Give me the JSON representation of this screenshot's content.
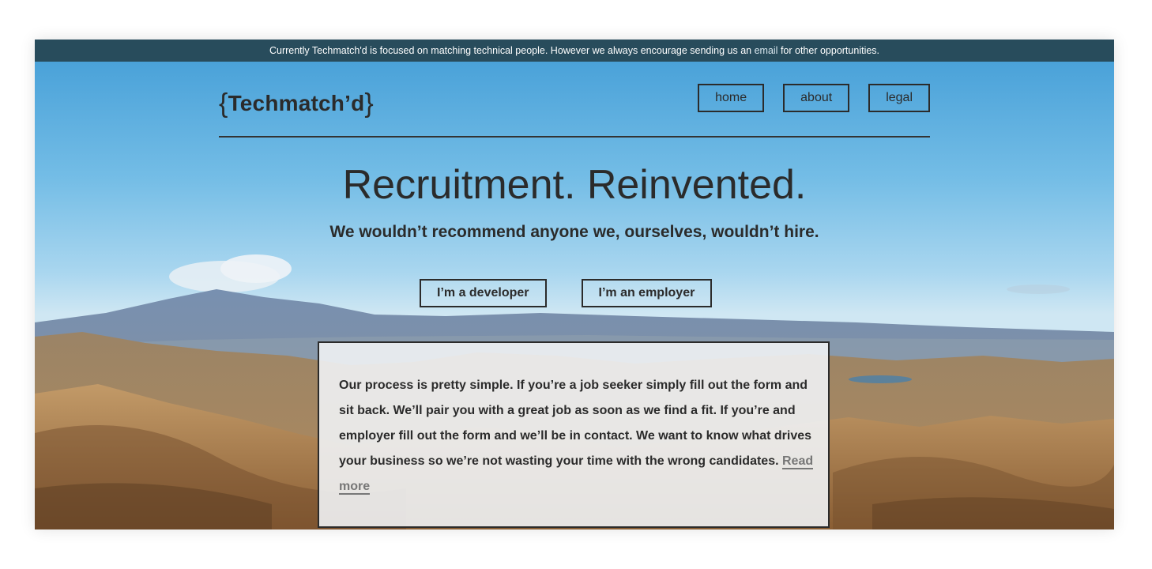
{
  "banner": {
    "text_before": "Currently Techmatch'd is focused on matching technical people. However we always encourage sending us an ",
    "email_link": "email",
    "text_after": " for other opportunities."
  },
  "header": {
    "logo_open": "{",
    "logo_text": "Techmatch’d",
    "logo_close": "}",
    "nav": {
      "home": "home",
      "about": "about",
      "legal": "legal"
    }
  },
  "hero": {
    "headline": "Recruitment. Reinvented.",
    "subhead": "We wouldn’t recommend anyone we, ourselves, wouldn’t hire.",
    "developer_button": "I’m a developer",
    "employer_button": "I’m an employer"
  },
  "info": {
    "body": "Our process is pretty simple. If you’re a job seeker simply fill out the form and sit back. We’ll pair you with a great job as soon as we find a fit. If you’re and employer fill out the form and we’ll be in contact. We want to know what drives your business so we’re not wasting your time with the wrong candidates. ",
    "read_more": "Read more"
  },
  "colors": {
    "banner_bg": "#284c5c",
    "text_dark": "#2b2b2b",
    "link_muted": "#777777"
  }
}
